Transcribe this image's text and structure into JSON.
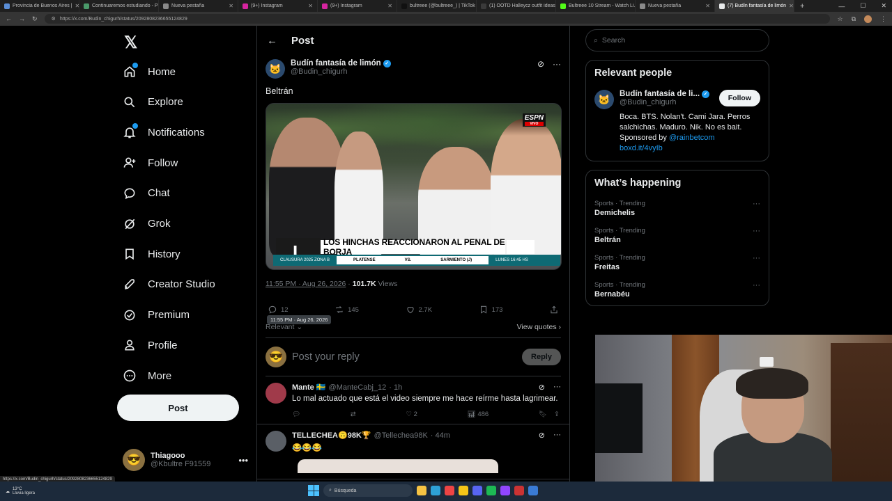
{
  "browser": {
    "tabs": [
      {
        "title": "Provincia de Buenos Aires |",
        "color": "#5a8dd6"
      },
      {
        "title": "Continuaremos estudiando - Plan",
        "color": "#4a9a6a"
      },
      {
        "title": "Nueva pestaña",
        "color": "#8a8a8a"
      },
      {
        "title": "(9+) Instagram",
        "color": "#d6249f"
      },
      {
        "title": "(9+) Instagram",
        "color": "#d6249f"
      },
      {
        "title": "bultreee (@bultreee_) | TikTok",
        "color": "#111111"
      },
      {
        "title": "(1) OOTD Halleycz outfit ideas",
        "color": "#3a3a3a"
      },
      {
        "title": "Bultreee 10 Stream - Watch Li...",
        "color": "#53fc18"
      },
      {
        "title": "Nueva pestaña",
        "color": "#8a8a8a"
      },
      {
        "title": "(7) Budín fantasía de limón",
        "color": "#e7e9ea"
      }
    ],
    "url": "https://x.com/Budin_chigurh/status/2092808236655124829"
  },
  "nav": {
    "items": [
      {
        "label": "Home",
        "icon": "home-icon",
        "dot": true
      },
      {
        "label": "Explore",
        "icon": "search-icon",
        "dot": false
      },
      {
        "label": "Notifications",
        "icon": "bell-icon",
        "dot": true
      },
      {
        "label": "Follow",
        "icon": "add-person-icon",
        "dot": false
      },
      {
        "label": "Chat",
        "icon": "chat-icon",
        "dot": false
      },
      {
        "label": "Grok",
        "icon": "grok-icon",
        "dot": false
      },
      {
        "label": "History",
        "icon": "bookmark-icon",
        "dot": false
      },
      {
        "label": "Creator Studio",
        "icon": "rocket-icon",
        "dot": false
      },
      {
        "label": "Premium",
        "icon": "premium-icon",
        "dot": false
      },
      {
        "label": "Profile",
        "icon": "person-icon",
        "dot": false
      },
      {
        "label": "More",
        "icon": "more-circle-icon",
        "dot": false
      }
    ],
    "post_label": "Post",
    "me": {
      "name": "Thiagooo",
      "handle": "@Kbultre F91559"
    }
  },
  "main": {
    "header": "Post",
    "tweet": {
      "author": "Budín fantasía de limón",
      "handle": "@Budin_chigurh",
      "text": "Beltrán",
      "media": {
        "channel": "ESPN",
        "channel_sub": "VIVO",
        "headline": "LOS HINCHAS REACCIONARON AL PENAL DE BORJA",
        "tournament": "CLAUSURA 2025 ZONA B",
        "home": "PLATENSE",
        "vs": "VS.",
        "away": "SARMIENTO (J)",
        "when": "LUNES 16:45 HS"
      },
      "time": "11:55 PM · Aug 26, 2026",
      "views_count": "101.7K",
      "views_label": "Views",
      "tooltip": "11:55 PM · Aug 26, 2026",
      "replies": "12",
      "reposts": "145",
      "likes": "2.7K",
      "bookmarks": "173"
    },
    "sort": "Relevant",
    "view_quotes": "View quotes",
    "reply_placeholder": "Post your reply",
    "reply_button": "Reply",
    "replies": [
      {
        "name": "Mante 🇸🇪",
        "handle": "@ManteCabj_12",
        "time": "· 1h",
        "text": "Lo mal actuado que está el video siempre me hace reírme hasta lagrimear.",
        "replies": "",
        "reposts": "",
        "likes": "2",
        "views": "486",
        "avatar_color": "#a03a4a"
      },
      {
        "name": "TELLECHEA🙃98K🏆",
        "handle": "@Tellechea98K",
        "time": "· 44m",
        "text": "😂😂😂",
        "avatar_color": "#5a5f66"
      }
    ]
  },
  "right": {
    "search_placeholder": "Search",
    "relevant_title": "Relevant people",
    "person": {
      "name": "Budín fantasía de li...",
      "handle": "@Budin_chigurh",
      "follow": "Follow",
      "bio": "Boca. BTS. Nolan't. Cami Jara. Perros salchichas. Maduro. Nik. No es bait.",
      "sponsored": "Sponsored by",
      "sponsor_link": "@rainbetcom",
      "link": "boxd.it/4vyIb"
    },
    "happening_title": "What’s happening",
    "trends": [
      {
        "category": "Sports · Trending",
        "name": "Demichelis"
      },
      {
        "category": "Sports · Trending",
        "name": "Beltrán"
      },
      {
        "category": "Sports · Trending",
        "name": "Freitas"
      },
      {
        "category": "Sports · Trending",
        "name": "Bernabéu"
      }
    ]
  },
  "taskbar": {
    "temp": "13°C",
    "weather": "Lluvia ligera",
    "search": "Búsqueda"
  },
  "status_url": "https://x.com/Budin_chigurh/status/2092808236655124829",
  "colors": {
    "accent": "#1d9bf0",
    "bg": "#000000",
    "border": "#2f3336",
    "muted": "#71767b"
  }
}
